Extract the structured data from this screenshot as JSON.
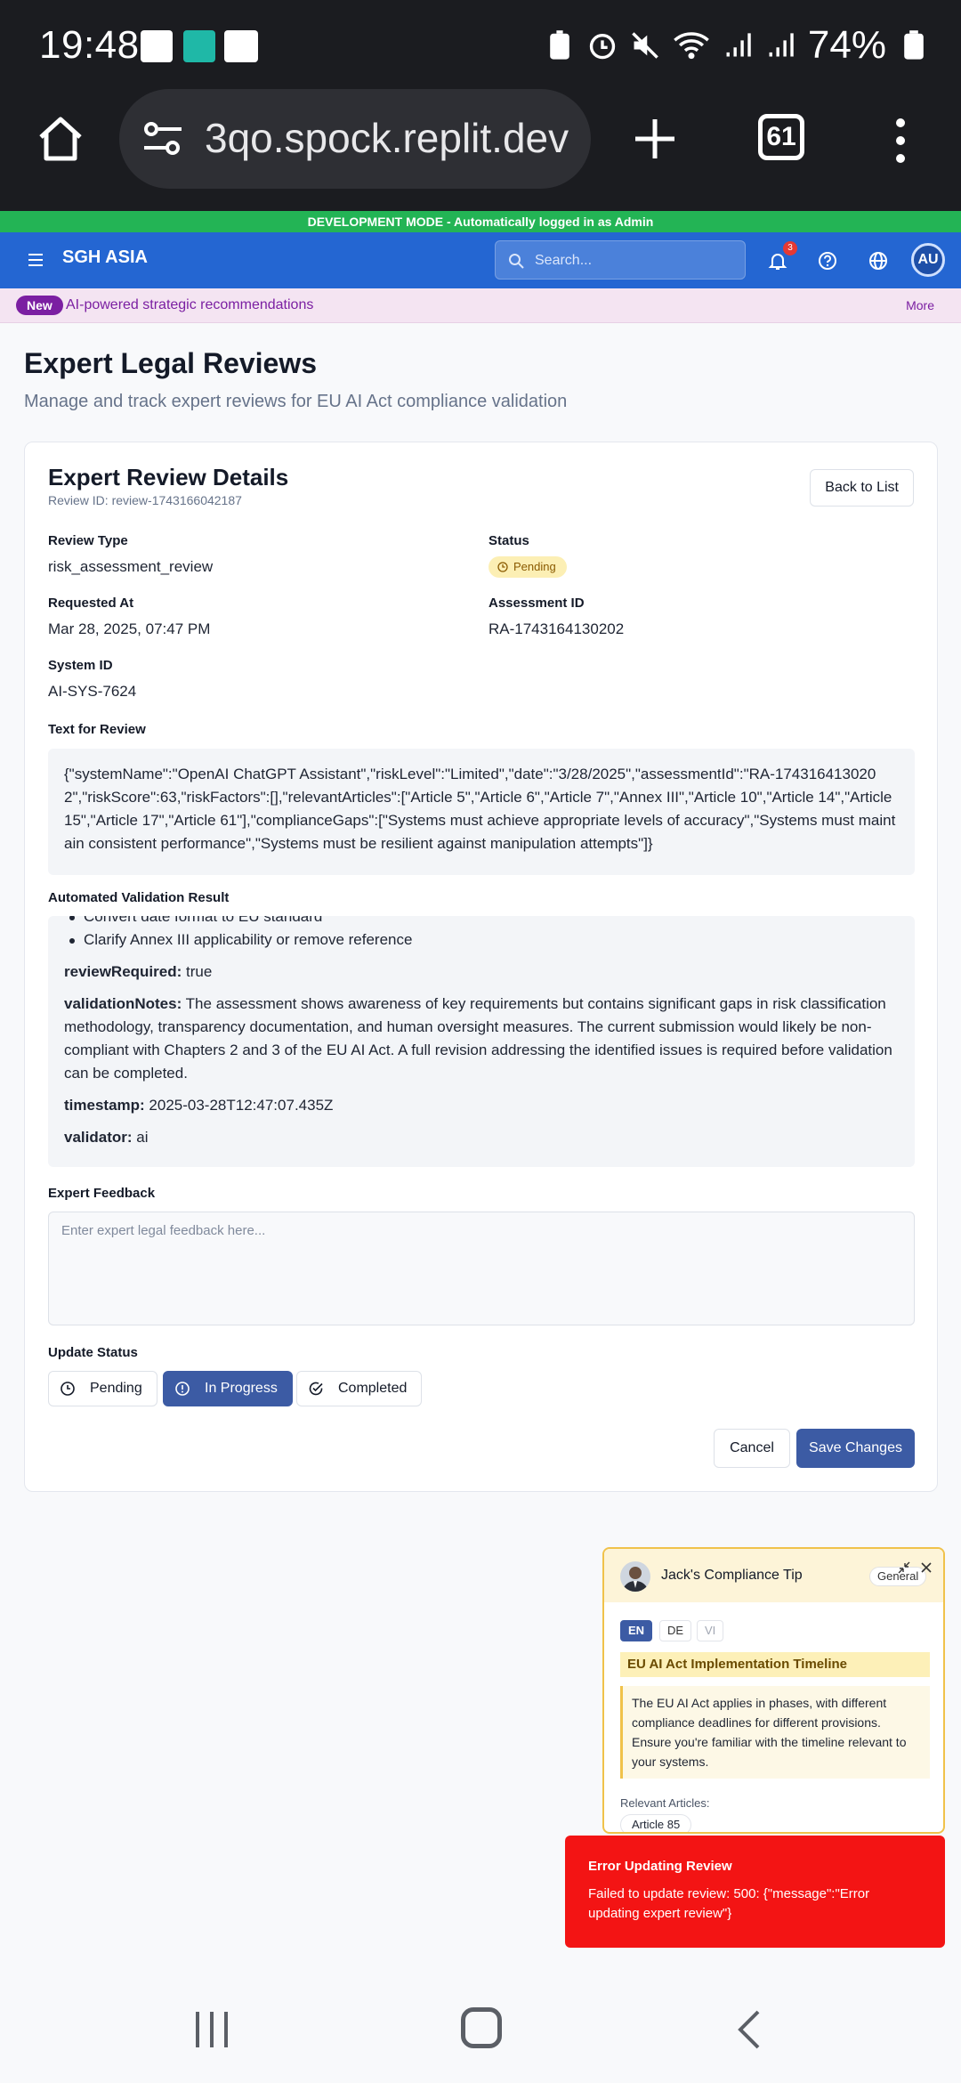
{
  "status_bar": {
    "time": "19:48",
    "battery": "74%",
    "colors": {
      "bg": "#1b1c20",
      "fg": "#ffffff"
    }
  },
  "browser": {
    "url": "3qo.spock.replit.dev",
    "tab_count": "61"
  },
  "dev_banner": {
    "text": "DEVELOPMENT MODE - Automatically logged in as Admin",
    "color": "#23b455"
  },
  "header": {
    "brand": "SGH ASIA",
    "search_placeholder": "Search...",
    "notification_count": "3",
    "avatar_initials": "AU",
    "color": "#2466d2"
  },
  "promo": {
    "badge": "New",
    "text": "AI-powered strategic recommendations",
    "more": "More"
  },
  "page": {
    "title": "Expert Legal Reviews",
    "subtitle": "Manage and track expert reviews for EU AI Act compliance validation"
  },
  "review": {
    "title": "Expert Review Details",
    "review_id": "Review ID: review-1743166042187",
    "back_label": "Back to List",
    "review_type_label": "Review Type",
    "review_type": "risk_assessment_review",
    "status_label": "Status",
    "status": "Pending",
    "requested_at_label": "Requested At",
    "requested_at": "Mar 28, 2025, 07:47 PM",
    "assessment_id_label": "Assessment ID",
    "assessment_id": "RA-1743164130202",
    "system_id_label": "System ID",
    "system_id": "AI-SYS-7624",
    "text_for_review_label": "Text for Review",
    "text_for_review": "{\"systemName\":\"OpenAI ChatGPT Assistant\",\"riskLevel\":\"Limited\",\"date\":\"3/28/2025\",\"assessmentId\":\"RA-1743164130202\",\"riskScore\":63,\"riskFactors\":[],\"relevantArticles\":[\"Article 5\",\"Article 6\",\"Article 7\",\"Annex III\",\"Article 10\",\"Article 14\",\"Article 15\",\"Article 17\",\"Article 61\"],\"complianceGaps\":[\"Systems must achieve appropriate levels of accuracy\",\"Systems must maintain consistent performance\",\"Systems must be resilient against manipulation attempts\"]}",
    "validation_label": "Automated Validation Result",
    "validation_cut_item": "Convert date format to EU standard",
    "validation_item": "Clarify Annex III applicability or remove reference",
    "review_required_key": "reviewRequired:",
    "review_required_value": "true",
    "validation_notes_key": "validationNotes:",
    "validation_notes_value": "The assessment shows awareness of key requirements but contains significant gaps in risk classification methodology, transparency documentation, and human oversight measures. The current submission would likely be non-compliant with Chapters 2 and 3 of the EU AI Act. A full revision addressing the identified issues is required before validation can be completed.",
    "timestamp_key": "timestamp:",
    "timestamp_value": "2025-03-28T12:47:07.435Z",
    "validator_key": "validator:",
    "validator_value": "ai",
    "feedback_label": "Expert Feedback",
    "feedback_placeholder": "Enter expert legal feedback here...",
    "feedback_value": "",
    "update_status_label": "Update Status",
    "status_options": [
      "Pending",
      "In Progress",
      "Completed"
    ],
    "selected_status": "In Progress",
    "cancel_label": "Cancel",
    "save_label": "Save Changes",
    "accent": "#3c5ba4"
  },
  "tip": {
    "title": "Jack's Compliance Tip",
    "category": "General",
    "languages": [
      "EN",
      "DE",
      "VI"
    ],
    "active_language": "EN",
    "heading": "EU AI Act Implementation Timeline",
    "body": "The EU AI Act applies in phases, with different compliance deadlines for different provisions. Ensure you're familiar with the timeline relevant to your systems.",
    "relevant_label": "Relevant Articles:",
    "article": "Article 85"
  },
  "toast": {
    "title": "Error Updating Review",
    "message": "Failed to update review: 500: {\"message\":\"Error updating expert review\"}",
    "color": "#f31414"
  }
}
